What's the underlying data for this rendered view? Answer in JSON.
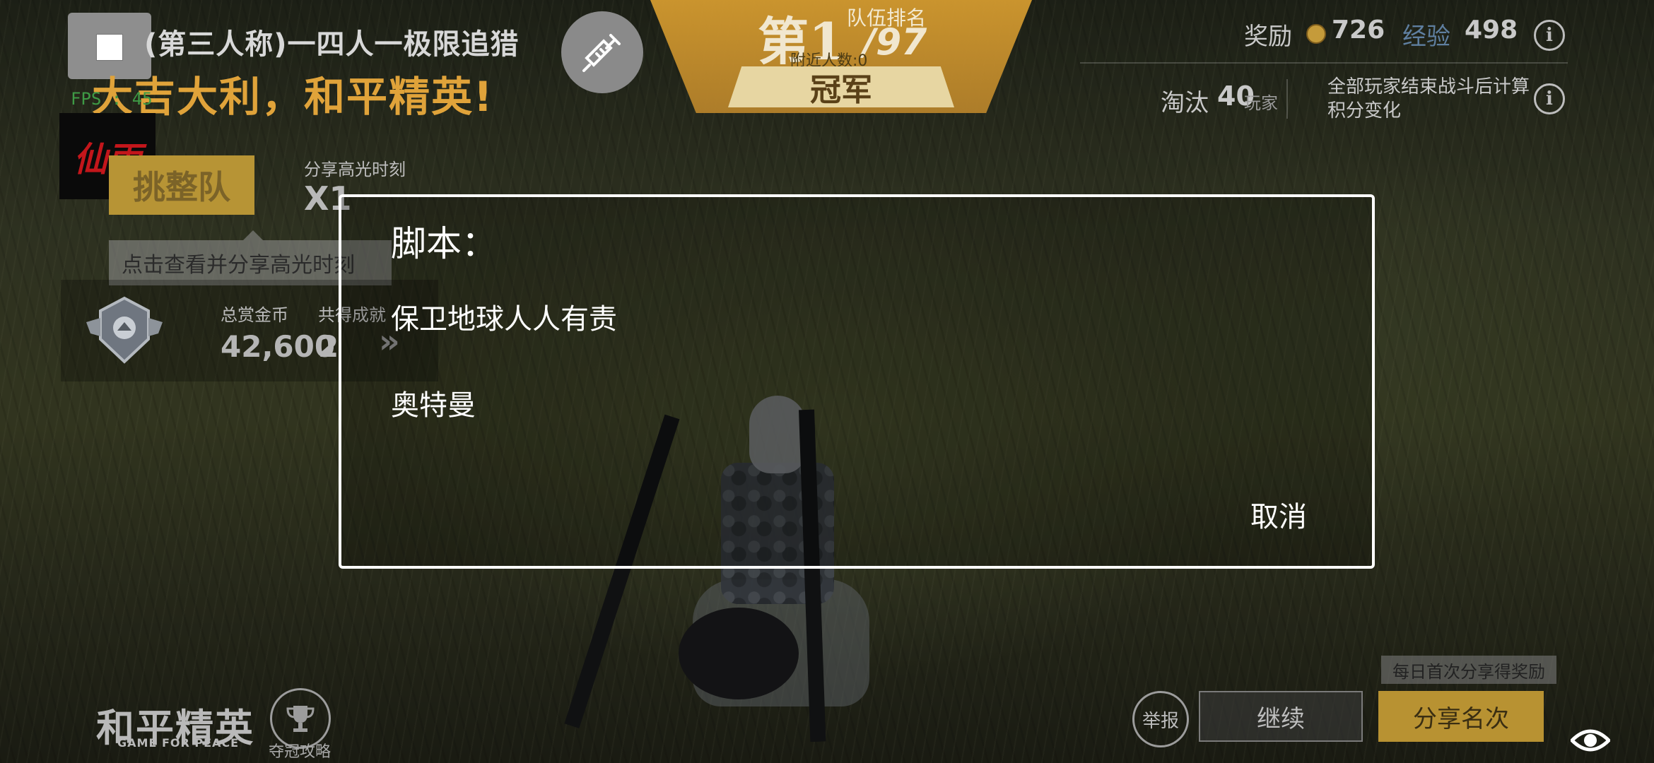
{
  "hud": {
    "mode_title": "(第三人称)一四人一极限追猎",
    "slogan": "大吉大利，和平精英!",
    "fps": "FPS : 45",
    "overlay_logo": "仙雨",
    "squad_button": "挑整队",
    "highlight_label": "分享高光时刻",
    "highlight_value": "X1",
    "tooltip": "点击查看并分享高光时刻",
    "bounty_label": "总赏金币",
    "bounty_value": "42,600",
    "achievement_label": "共得成就",
    "achievement_value": "2",
    "chevrons": "»"
  },
  "rank": {
    "prefix": "第1",
    "total": "/97",
    "label": "队伍排名",
    "nearby": "附近人数:0",
    "champion": "冠军"
  },
  "rewards": {
    "reward_label": "奖励",
    "reward_value": "726",
    "exp_label": "经验",
    "exp_value": "498",
    "elim_label": "淘汰",
    "elim_value": "40",
    "elim_unit": "玩家",
    "note": "全部玩家结束战斗后计算积分变化",
    "info_glyph": "i"
  },
  "bottom": {
    "logo": "和平精英",
    "logo_sub": "GAME FOR PEACE",
    "trophy_label": "夺冠攻略",
    "report": "举报",
    "continue": "继续",
    "share_rank": "分享名次",
    "share_tip": "每日首次分享得奖励"
  },
  "dialog": {
    "title": "脚本：",
    "items": [
      "保卫地球人人有责",
      "奥特曼"
    ],
    "cancel": "取消"
  },
  "icons": {
    "syringe": "syringe-icon",
    "eye": "eye-icon",
    "trophy": "trophy-icon",
    "rank_badge": "rank-badge-icon",
    "coin": "coin-icon",
    "info": "info-icon",
    "stop": "stop-square-icon"
  },
  "colors": {
    "accent_gold": "#b89232",
    "logo_red": "#c3161b",
    "fps_green": "#3e9a45",
    "exp_blue": "#5f7fa0"
  }
}
